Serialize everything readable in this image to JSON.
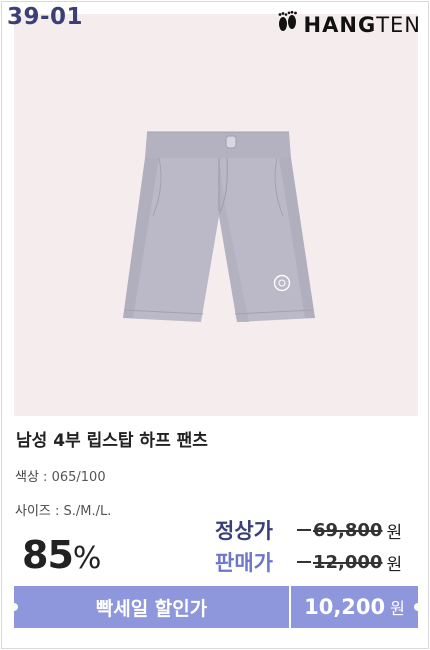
{
  "product": {
    "code": "39-01",
    "brand_name_bold": "HANG",
    "brand_name_thin": "TEN",
    "title": "남성 4부 립스탑 하프 팬츠"
  },
  "details": {
    "color_label": "색상",
    "color_value": "065/100",
    "size_label": "사이즈",
    "size_value": "S./M./L."
  },
  "pricing": {
    "discount_number": "85",
    "discount_symbol": "%",
    "regular_label": "정상가",
    "regular_price": "69,800",
    "sale_label": "판매가",
    "sale_price": "12,000",
    "currency": "원"
  },
  "promo_bar": {
    "label": "빡세일 할인가",
    "price": "10,200",
    "currency": "원"
  },
  "colors": {
    "brand_navy": "#3a3f78",
    "sale_purple": "#6d76c9",
    "bar_bg": "#8f97dc",
    "photo_bg": "#f5ecee",
    "garment": "#b8b6c4"
  },
  "icons": {
    "brand_logo": "footprints-icon",
    "garment_emblem": "circle-logo-icon"
  }
}
